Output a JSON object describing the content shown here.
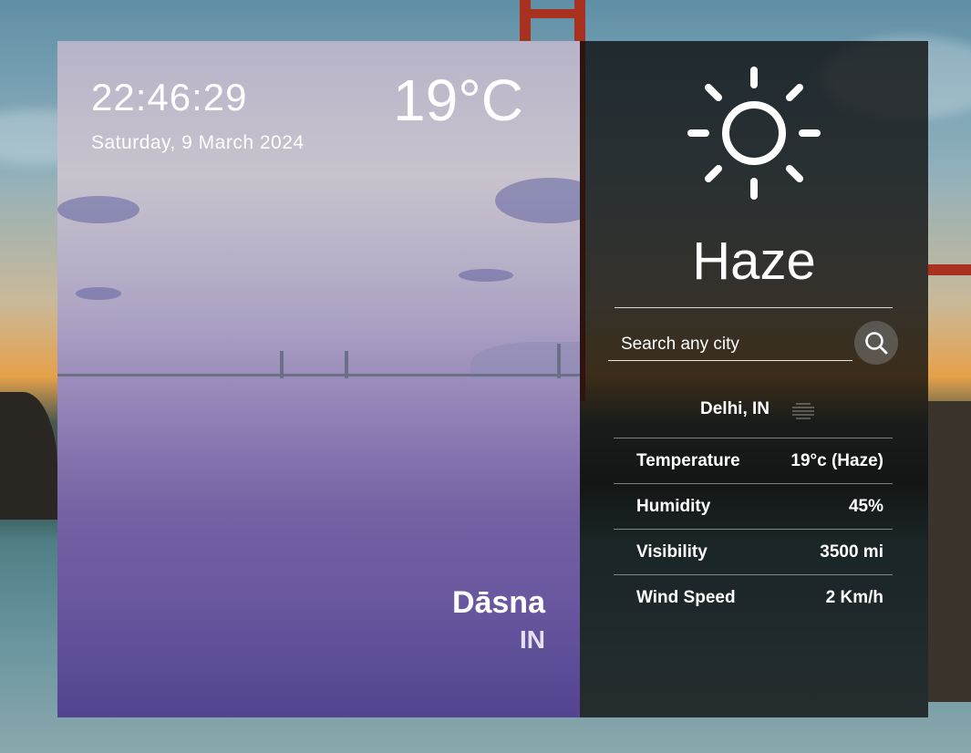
{
  "clock": {
    "time": "22:46:29",
    "date": "Saturday, 9 March 2024"
  },
  "current": {
    "temperature": "19°C",
    "city": "Dāsna",
    "country": "IN"
  },
  "weather": {
    "condition": "Haze",
    "icon": "sun-icon"
  },
  "search": {
    "placeholder": "Search any city",
    "value": ""
  },
  "details": {
    "location": "Delhi, IN",
    "location_icon": "haze-icon",
    "rows": [
      {
        "label": "Temperature",
        "value": "19°c (Haze)"
      },
      {
        "label": "Humidity",
        "value": "45%"
      },
      {
        "label": "Visibility",
        "value": "3500 mi"
      },
      {
        "label": "Wind Speed",
        "value": "2 Km/h"
      }
    ]
  }
}
